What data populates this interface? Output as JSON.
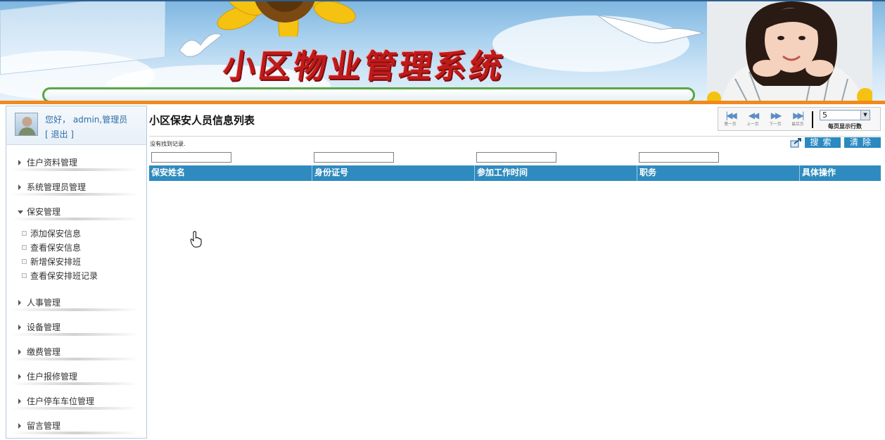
{
  "banner": {
    "title": "小区物业管理系统"
  },
  "sidebar": {
    "greeting": "您好，  admin,管理员",
    "logout": "[ 退出 ]",
    "menu": [
      {
        "label": "住户资料管理",
        "expanded": false
      },
      {
        "label": "系统管理员管理",
        "expanded": false
      },
      {
        "label": "保安管理",
        "expanded": true,
        "children": [
          "添加保安信息",
          "查看保安信息",
          "新增保安排班",
          "查看保安排班记录"
        ]
      },
      {
        "label": "人事管理",
        "expanded": false
      },
      {
        "label": "设备管理",
        "expanded": false
      },
      {
        "label": "缴费管理",
        "expanded": false
      },
      {
        "label": "住户报修管理",
        "expanded": false
      },
      {
        "label": "住户停车车位管理",
        "expanded": false
      },
      {
        "label": "留言管理",
        "expanded": false
      }
    ]
  },
  "main": {
    "page_title": "小区保安人员信息列表",
    "pager": {
      "first": "第一页",
      "prev": "上一页",
      "next": "下一页",
      "last": "最后页",
      "page_size_value": "5",
      "page_size_label": "每页显示行数"
    },
    "empty_message": "没有找到记录.",
    "search_label": "搜索",
    "clear_label": "清除",
    "filters": [
      "",
      "",
      "",
      ""
    ],
    "columns": [
      "保安姓名",
      "身份证号",
      "参加工作时间",
      "职务",
      "具体操作"
    ]
  },
  "colors": {
    "accent": "#2f8bbf",
    "banner_stripe": "#f08a1c",
    "title_red": "#c01a1a",
    "link_blue": "#2d6ea8"
  },
  "icons": [
    "first-page-icon",
    "prev-page-icon",
    "next-page-icon",
    "last-page-icon",
    "export-icon",
    "hand-cursor-icon"
  ]
}
